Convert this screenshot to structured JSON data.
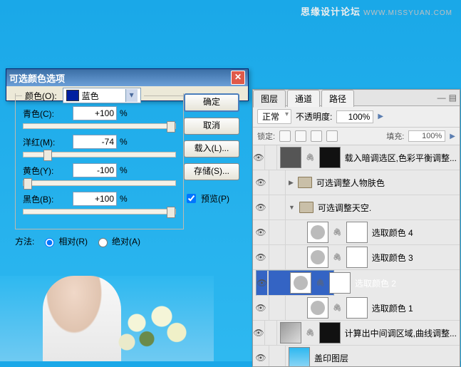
{
  "watermark": {
    "site": "思缘设计论坛",
    "url": "WWW.MISSYUAN.COM"
  },
  "dialog": {
    "title": "可选颜色选项",
    "color_label": "颜色(O):",
    "color_value": "蓝色",
    "sliders": {
      "cyan": {
        "label": "青色(C):",
        "value": "+100"
      },
      "magenta": {
        "label": "洋红(M):",
        "value": "-74"
      },
      "yellow": {
        "label": "黄色(Y):",
        "value": "-100"
      },
      "black": {
        "label": "黑色(B):",
        "value": "+100"
      }
    },
    "percent": "%",
    "method_label": "方法:",
    "method_rel": "相对(R)",
    "method_abs": "绝对(A)",
    "buttons": {
      "ok": "确定",
      "cancel": "取消",
      "load": "载入(L)...",
      "save": "存储(S)..."
    },
    "preview": "预览(P)"
  },
  "panel": {
    "tabs": {
      "layers": "图层",
      "channels": "通道",
      "paths": "路径"
    },
    "blend": "正常",
    "opacity_label": "不透明度:",
    "opacity": "100%",
    "lock_label": "锁定:",
    "fill_label": "填充:",
    "fill": "100%",
    "items": {
      "i0": "载入暗调选区,色彩平衡调整...",
      "g1": "可选调整人物肤色",
      "g2": "可选调整天空.",
      "s1": "选取颜色 4",
      "s2": "选取颜色 3",
      "s3": "选取颜色 2",
      "s4": "选取颜色 1",
      "i5": "计算出中间调区域,曲线调整...",
      "i6": "盖印图层"
    }
  }
}
